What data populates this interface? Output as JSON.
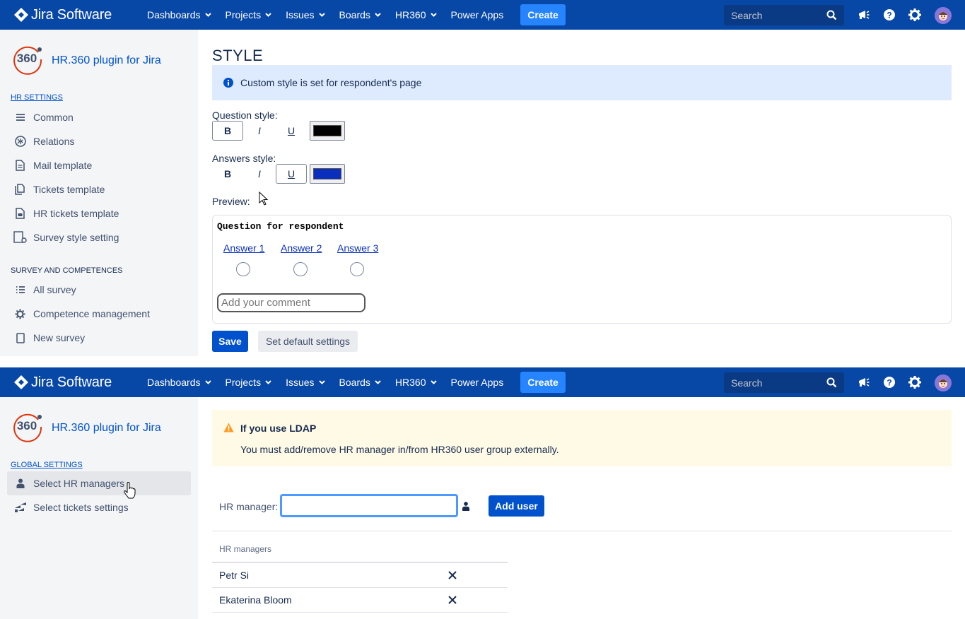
{
  "app": {
    "logo_text": "Jira Software",
    "menu": [
      "Dashboards",
      "Projects",
      "Issues",
      "Boards",
      "HR360",
      "Power Apps"
    ],
    "menu_has_dropdown": [
      true,
      true,
      true,
      true,
      true,
      false
    ],
    "create_label": "Create",
    "search_placeholder": "Search",
    "icons": [
      "megaphone-icon",
      "help-icon",
      "gear-icon",
      "user-avatar"
    ]
  },
  "plugin": {
    "badge": "360",
    "name": "HR.360 plugin for Jira"
  },
  "panel1": {
    "sidebar": {
      "section1": "HR SETTINGS",
      "items1": [
        "Common",
        "Relations",
        "Mail template",
        "Tickets template",
        "HR tickets template",
        "Survey style setting"
      ],
      "section2": "SURVEY AND COMPETENCES",
      "items2": [
        "All survey",
        "Competence management",
        "New survey"
      ]
    },
    "main": {
      "title": "STYLE",
      "info": "Custom style is set for respondent's page",
      "question_style_label": "Question style:",
      "answers_style_label": "Answers style:",
      "style_buttons": {
        "bold": "B",
        "italic": "I",
        "underline": "U"
      },
      "question_style": {
        "bold": true,
        "italic": false,
        "underline": false,
        "color": "#000000"
      },
      "answers_style": {
        "bold": false,
        "italic": false,
        "underline": true,
        "color": "#0a2fbf"
      },
      "preview_label": "Preview:",
      "preview": {
        "question": "Question for respondent",
        "answers": [
          "Answer 1",
          "Answer 2",
          "Answer 3"
        ],
        "comment_placeholder": "Add your comment"
      },
      "save_label": "Save",
      "default_label": "Set default settings"
    }
  },
  "panel2": {
    "sidebar": {
      "section": "GLOBAL SETTINGS",
      "items": [
        "Select HR managers",
        "Select tickets settings"
      ],
      "active_index": 0
    },
    "main": {
      "warning_title": "If you use LDAP",
      "warning_text": "You must add/remove HR manager in/from HR360 user group externally.",
      "hr_manager_label": "HR manager:",
      "hr_manager_value": "",
      "add_user_label": "Add user",
      "table_header": "HR managers",
      "managers": [
        "Petr Si",
        "Ekaterina Bloom"
      ]
    }
  },
  "colors": {
    "nav_bg": "#0747a6",
    "create_bg": "#2684ff",
    "primary": "#0052cc",
    "info_bg": "#deebff",
    "warning_bg": "#fffae6",
    "warning_icon": "#ff991f",
    "sidebar_bg": "#f4f5f7"
  }
}
